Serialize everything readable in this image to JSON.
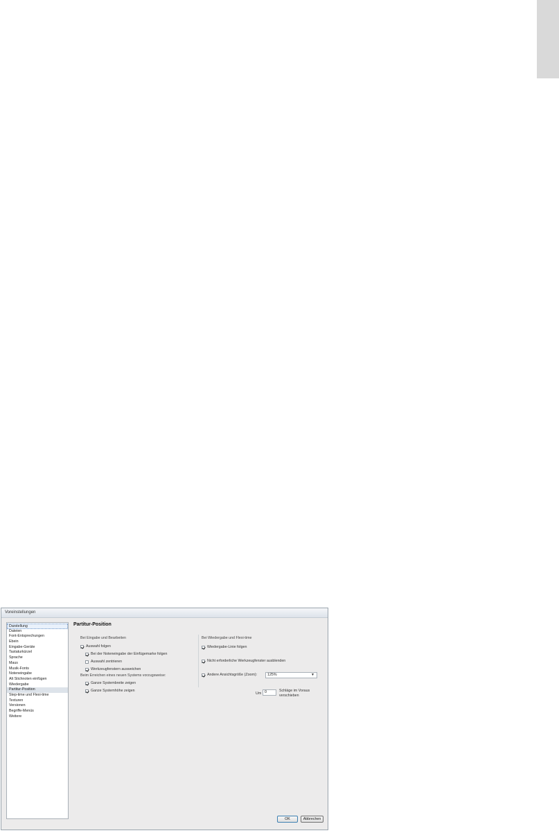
{
  "dialog": {
    "title": "Voreinstellungen",
    "categories": [
      "Darstellung",
      "Dateien",
      "Font-Entsprechungen",
      "Ebein",
      "Eingabe-Geräte",
      "Tastaturkürzel",
      "Sprache",
      "Maus",
      "Musik-Fonts",
      "Noteneingabe",
      "Alt Stichnoten einfügen",
      "Wiedergabe",
      "Partitur-Position",
      "Step-time und Flexi-time",
      "Texturen",
      "Versionen",
      "Begriffe-Menüs",
      "Weitere"
    ],
    "selected_category": "Partitur-Position",
    "heading": "Partitur-Position",
    "left_section": {
      "title": "Bei Eingabe und Bearbeiten",
      "follow_selection": {
        "label": "Auswahl folgen",
        "checked": true
      },
      "follow_caret": {
        "label": "Bei der Noteneingabe der Einfügemarke folgen",
        "checked": true
      },
      "center_selection": {
        "label": "Auswahl zentrieren",
        "checked": false
      },
      "avoid_toolwindows": {
        "label": "Werkzeugfenstern ausweichen",
        "checked": true
      },
      "new_system_title": "Beim Erreichen eines neuen Systems vorzugsweise:",
      "show_system_width": {
        "label": "Ganze Systembreite zeigen",
        "checked": true
      },
      "show_system_height": {
        "label": "Ganze Systemhöhe zeigen",
        "checked": true
      }
    },
    "right_section": {
      "title": "Bei Wiedergabe und Flexi-time",
      "follow_playback_line": {
        "label": "Wiedergabe-Linie folgen",
        "checked": true
      },
      "hide_toolwindows": {
        "label": "Nicht erforderliche Werkzeugfenster ausblenden",
        "checked": true
      },
      "change_zoom": {
        "label": "Andere Ansichtsgröße (Zoom):",
        "checked": true
      },
      "zoom_value": "125%",
      "um_label": "Um",
      "beats_value": "0",
      "beats_label": "Schläge im Voraus verschieben"
    },
    "buttons": {
      "ok": "OK",
      "cancel": "Abbrechen"
    }
  }
}
